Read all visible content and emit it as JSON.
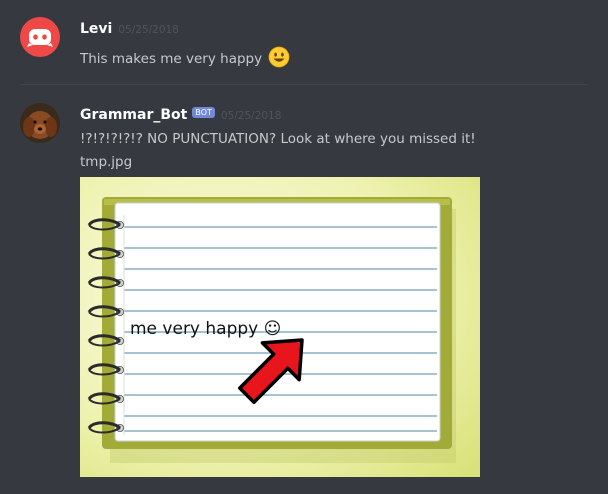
{
  "messages": [
    {
      "author": "Levi",
      "timestamp": "05/25/2018",
      "text": "This makes me very happy",
      "emoji": "smiling-face-emoji",
      "avatar": "discord-logo-icon",
      "avatar_color": "#f04747"
    },
    {
      "author": "Grammar_Bot",
      "bot_tag": "BOT",
      "timestamp": "05/25/2018",
      "text": "!?!?!?!?!? NO PUNCTUATION? Look at where you missed it!",
      "attachment_name": "tmp.jpg",
      "avatar": "dog-photo-avatar",
      "image": {
        "note_text": "me very happy ☺",
        "arrow": "red-arrow-icon"
      }
    }
  ],
  "colors": {
    "background": "#36393f",
    "username": "#ffffff",
    "text": "#dcddde",
    "timestamp": "#4f545c",
    "bot_tag": "#7289da",
    "arrow": "#e8161c"
  }
}
